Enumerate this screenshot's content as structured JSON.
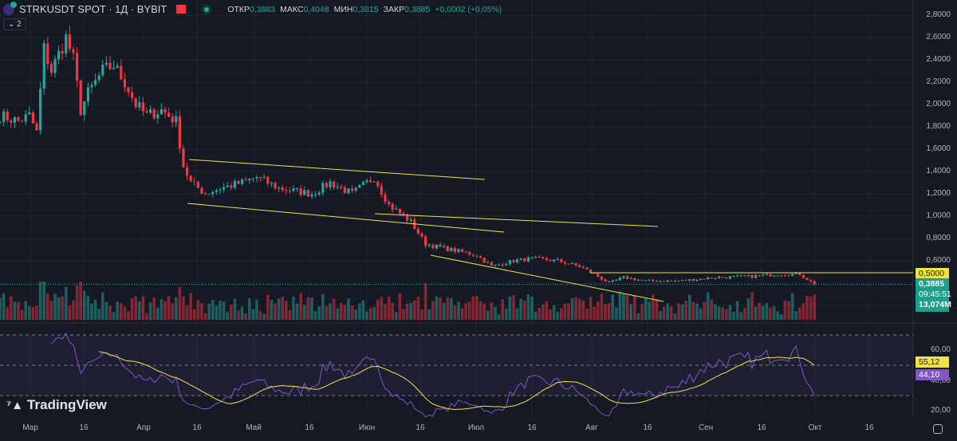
{
  "header": {
    "symbol": "STRKUSDT SPOT · 1Д · BYBIT",
    "open_label": "ОТКР",
    "open": "0,3883",
    "high_label": "МАКС",
    "high": "0,4048",
    "low_label": "МИН",
    "low": "0,3815",
    "close_label": "ЗАКР",
    "close": "0,3885",
    "change": "+0,0002 (+0,05%)",
    "collapse": "⌄ 2"
  },
  "price_axis": [
    "2,8000",
    "2,6000",
    "2,4000",
    "2,2000",
    "2,0000",
    "1,8000",
    "1,6000",
    "1,4000",
    "1,2000",
    "1,0000",
    "0,8000",
    "0,6000"
  ],
  "tags": {
    "level": "0,5000",
    "price": "0,3885",
    "countdown": "09:45:51",
    "volume": "13,074M",
    "rsi_ma": "55,12",
    "rsi": "44,10"
  },
  "rsi_axis": [
    "60,00",
    "40,00",
    "20,00"
  ],
  "time_axis": [
    "Мар",
    "16",
    "Апр",
    "16",
    "Май",
    "16",
    "Июн",
    "16",
    "Июл",
    "16",
    "Авг",
    "16",
    "Сен",
    "16",
    "Окт",
    "16"
  ],
  "brand": "TradingView",
  "colors": {
    "up": "#26a69a",
    "down": "#f23645",
    "line": "#f0e442",
    "rsi": "#7e57c2"
  },
  "chart_data": {
    "type": "candlestick",
    "anchors_day_price": [
      [
        0,
        1.9
      ],
      [
        5,
        1.85
      ],
      [
        8,
        1.9
      ],
      [
        10,
        1.75
      ],
      [
        12,
        2.5
      ],
      [
        14,
        2.3
      ],
      [
        18,
        2.6
      ],
      [
        20,
        2.4
      ],
      [
        22,
        1.95
      ],
      [
        24,
        2.1
      ],
      [
        28,
        2.3
      ],
      [
        31,
        2.35
      ],
      [
        34,
        2.2
      ],
      [
        37,
        2.0
      ],
      [
        40,
        1.9
      ],
      [
        44,
        1.95
      ],
      [
        48,
        1.85
      ],
      [
        50,
        1.45
      ],
      [
        52,
        1.3
      ],
      [
        56,
        1.2
      ],
      [
        60,
        1.25
      ],
      [
        66,
        1.3
      ],
      [
        70,
        1.35
      ],
      [
        76,
        1.25
      ],
      [
        85,
        1.2
      ],
      [
        90,
        1.3
      ],
      [
        96,
        1.2
      ],
      [
        102,
        1.35
      ],
      [
        106,
        1.1
      ],
      [
        112,
        0.95
      ],
      [
        116,
        0.75
      ],
      [
        120,
        0.72
      ],
      [
        130,
        0.65
      ],
      [
        134,
        0.55
      ],
      [
        140,
        0.6
      ],
      [
        145,
        0.62
      ],
      [
        152,
        0.6
      ],
      [
        158,
        0.55
      ],
      [
        162,
        0.48
      ],
      [
        166,
        0.4
      ],
      [
        170,
        0.45
      ],
      [
        176,
        0.42
      ],
      [
        185,
        0.42
      ],
      [
        195,
        0.45
      ],
      [
        205,
        0.46
      ],
      [
        212,
        0.48
      ],
      [
        218,
        0.48
      ],
      [
        222,
        0.3885
      ]
    ],
    "ylim": [
      0.3,
      2.8
    ]
  }
}
